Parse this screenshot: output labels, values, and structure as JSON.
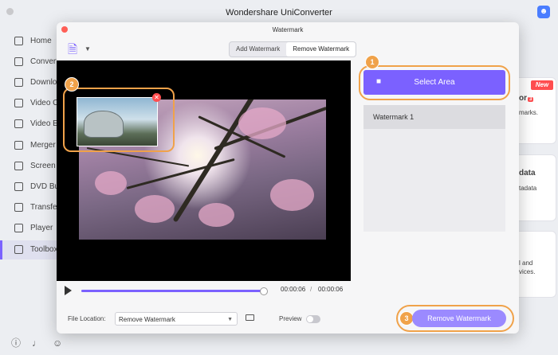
{
  "app": {
    "title": "Wondershare UniConverter"
  },
  "sidebar": {
    "items": [
      {
        "label": "Home"
      },
      {
        "label": "Converter"
      },
      {
        "label": "Downloader"
      },
      {
        "label": "Video Compressor"
      },
      {
        "label": "Video Editor"
      },
      {
        "label": "Merger"
      },
      {
        "label": "Screen Recorder"
      },
      {
        "label": "DVD Burner"
      },
      {
        "label": "Transfer"
      },
      {
        "label": "Player"
      },
      {
        "label": "Toolbox"
      }
    ],
    "active": "Toolbox"
  },
  "background": {
    "new_badge": "New",
    "card1_title": "or",
    "card1_count": "3",
    "card1_text": "marks.",
    "card2_title": "data",
    "card2_text": "tadata",
    "card3_text1": "l and",
    "card3_text2": "vices."
  },
  "dialog": {
    "title": "Watermark",
    "tabs": [
      {
        "label": "Add Watermark"
      },
      {
        "label": "Remove Watermark"
      }
    ],
    "active_tab": "Remove Watermark",
    "select_area_label": "Select Area",
    "watermark_list": [
      {
        "label": "Watermark 1"
      }
    ],
    "callouts": [
      "1",
      "2",
      "3"
    ],
    "player": {
      "current_time": "00:00:06",
      "separator": "/",
      "total_time": "00:00:06",
      "progress": 0.99
    },
    "footer": {
      "file_location_label": "File Location:",
      "file_location_value": "Remove Watermark",
      "preview_label": "Preview",
      "preview_on": false,
      "remove_button_label": "Remove Watermark"
    }
  },
  "colors": {
    "accent": "#7b61ff",
    "callout": "#f0a24a",
    "close": "#ff4d4f"
  }
}
